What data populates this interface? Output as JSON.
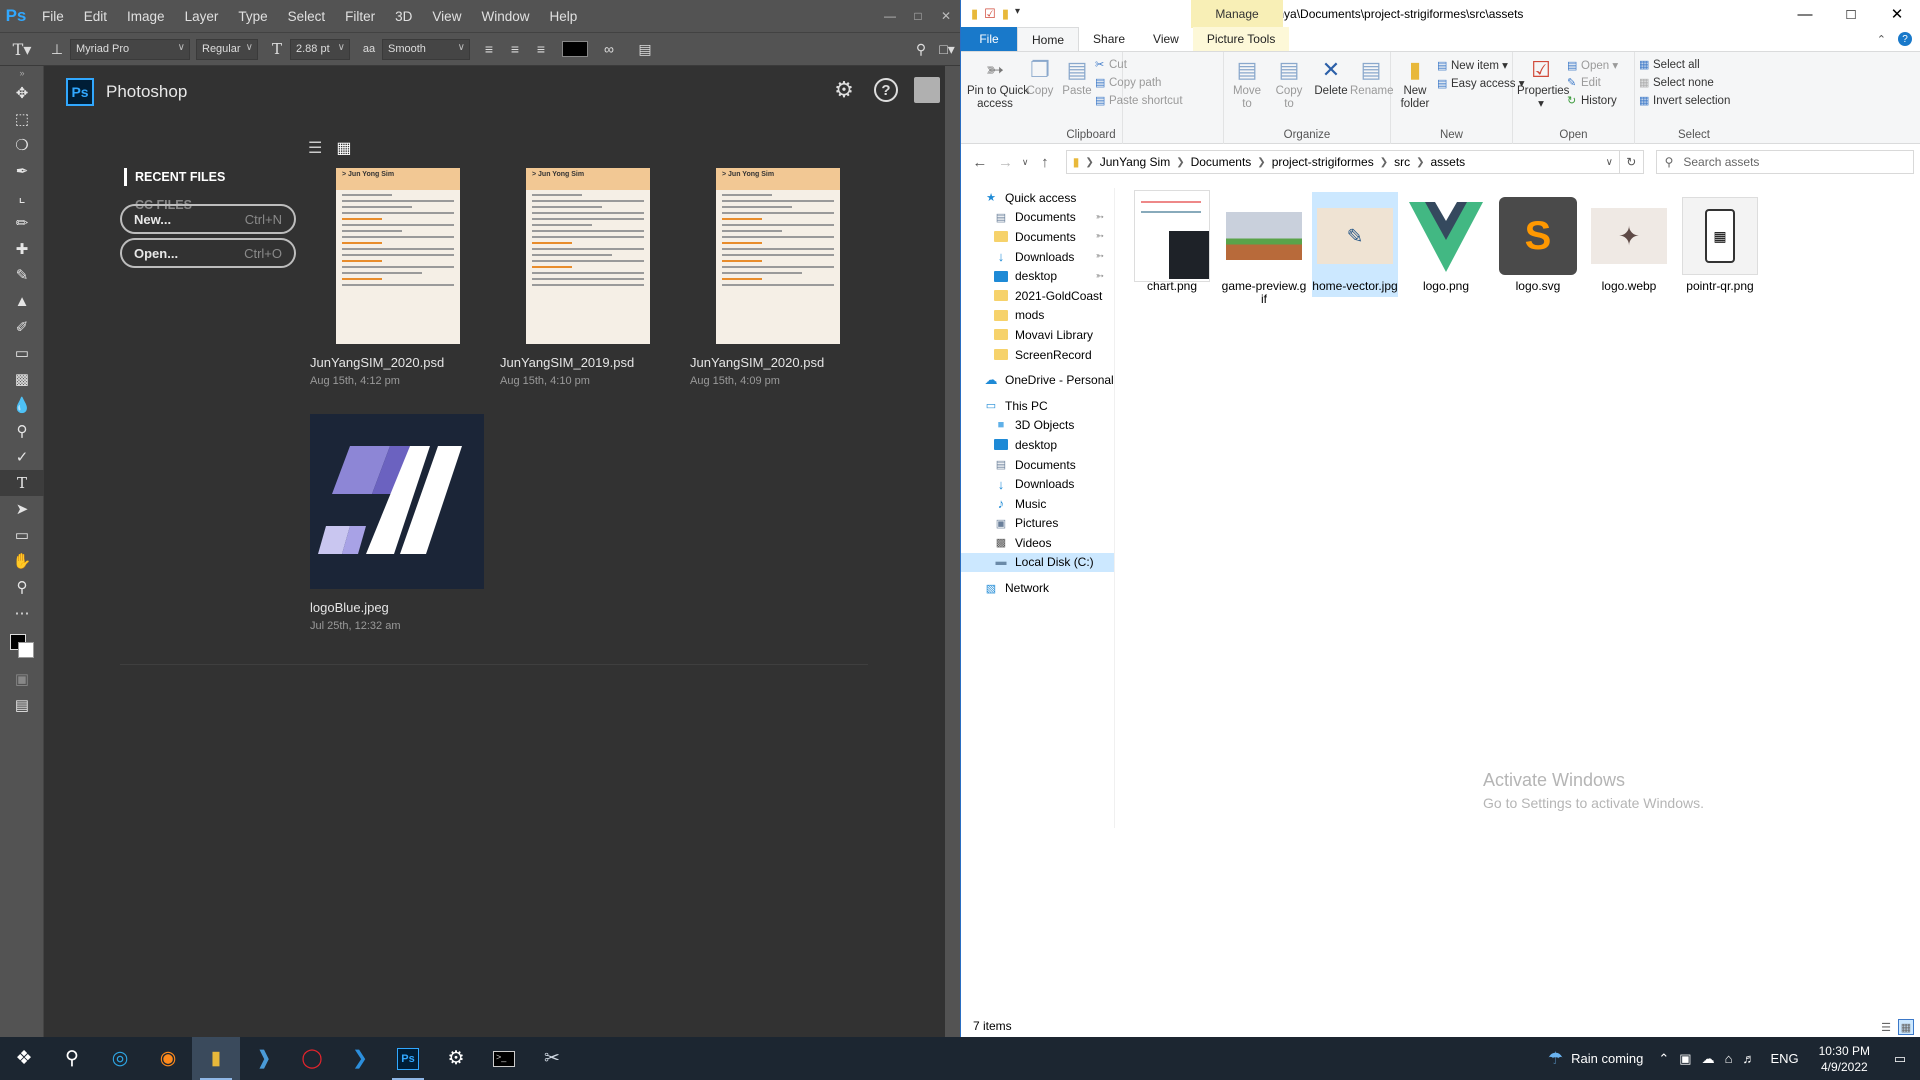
{
  "ps": {
    "logo": "Ps",
    "menu": [
      "File",
      "Edit",
      "Image",
      "Layer",
      "Type",
      "Select",
      "Filter",
      "3D",
      "View",
      "Window",
      "Help"
    ],
    "options": {
      "font_family": "Myriad Pro",
      "font_style": "Regular",
      "size": "2.88 pt",
      "antialias": "Smooth"
    },
    "home": {
      "app_title": "Photoshop",
      "nav_recent": "RECENT FILES",
      "nav_cc": "CC FILES",
      "new_label": "New...",
      "new_shortcut": "Ctrl+N",
      "open_label": "Open...",
      "open_shortcut": "Ctrl+O",
      "files": [
        {
          "name": "JunYangSIM_2020.psd",
          "date": "Aug 15th, 4:12 pm",
          "thumb_header": "> Jun Yong Sim"
        },
        {
          "name": "JunYangSIM_2019.psd",
          "date": "Aug 15th, 4:10 pm",
          "thumb_header": "> Jun Yong Sim"
        },
        {
          "name": "JunYangSIM_2020.psd",
          "date": "Aug 15th, 4:09 pm",
          "thumb_header": "> Jun Yong Sim"
        },
        {
          "name": "logoBlue.jpeg",
          "date": "Jul 25th, 12:32 am"
        }
      ]
    }
  },
  "explorer": {
    "title_path": "C:\\Users\\junya\\Documents\\project-strigiformes\\src\\assets",
    "manage_tab": "Manage",
    "tabs": [
      "File",
      "Home",
      "Share",
      "View",
      "Picture Tools"
    ],
    "ribbon": {
      "pin": "Pin to Quick\naccess",
      "copy": "Copy",
      "paste": "Paste",
      "cut": "Cut",
      "copy_path": "Copy path",
      "paste_shortcut": "Paste shortcut",
      "clipboard_label": "Clipboard",
      "move_to": "Move\nto",
      "copy_to": "Copy\nto",
      "delete": "Delete",
      "rename": "Rename",
      "organize_label": "Organize",
      "new_folder": "New\nfolder",
      "new_item": "New item",
      "easy_access": "Easy access",
      "new_label": "New",
      "properties": "Properties",
      "open": "Open",
      "edit": "Edit",
      "history": "History",
      "open_label": "Open",
      "select_all": "Select all",
      "select_none": "Select none",
      "invert_selection": "Invert selection",
      "select_label": "Select"
    },
    "breadcrumbs": [
      "JunYang Sim",
      "Documents",
      "project-strigiformes",
      "src",
      "assets"
    ],
    "search_placeholder": "Search assets",
    "nav": {
      "quick_access": "Quick access",
      "quick_items": [
        "Documents",
        "Documents",
        "Downloads",
        "desktop",
        "2021-GoldCoast",
        "mods",
        "Movavi Library",
        "ScreenRecord"
      ],
      "onedrive": "OneDrive - Personal",
      "this_pc": "This PC",
      "pc_items": [
        "3D Objects",
        "desktop",
        "Documents",
        "Downloads",
        "Music",
        "Pictures",
        "Videos",
        "Local Disk (C:)"
      ],
      "network": "Network"
    },
    "files": [
      "chart.png",
      "game-preview.gif",
      "home-vector.jpg",
      "logo.png",
      "logo.svg",
      "logo.webp",
      "pointr-qr.png"
    ],
    "selected_file": "home-vector.jpg",
    "status": "7 items",
    "watermark_title": "Activate Windows",
    "watermark_sub": "Go to Settings to activate Windows."
  },
  "taskbar": {
    "weather": "Rain coming",
    "lang": "ENG",
    "time": "10:30 PM",
    "date": "4/9/2022"
  }
}
